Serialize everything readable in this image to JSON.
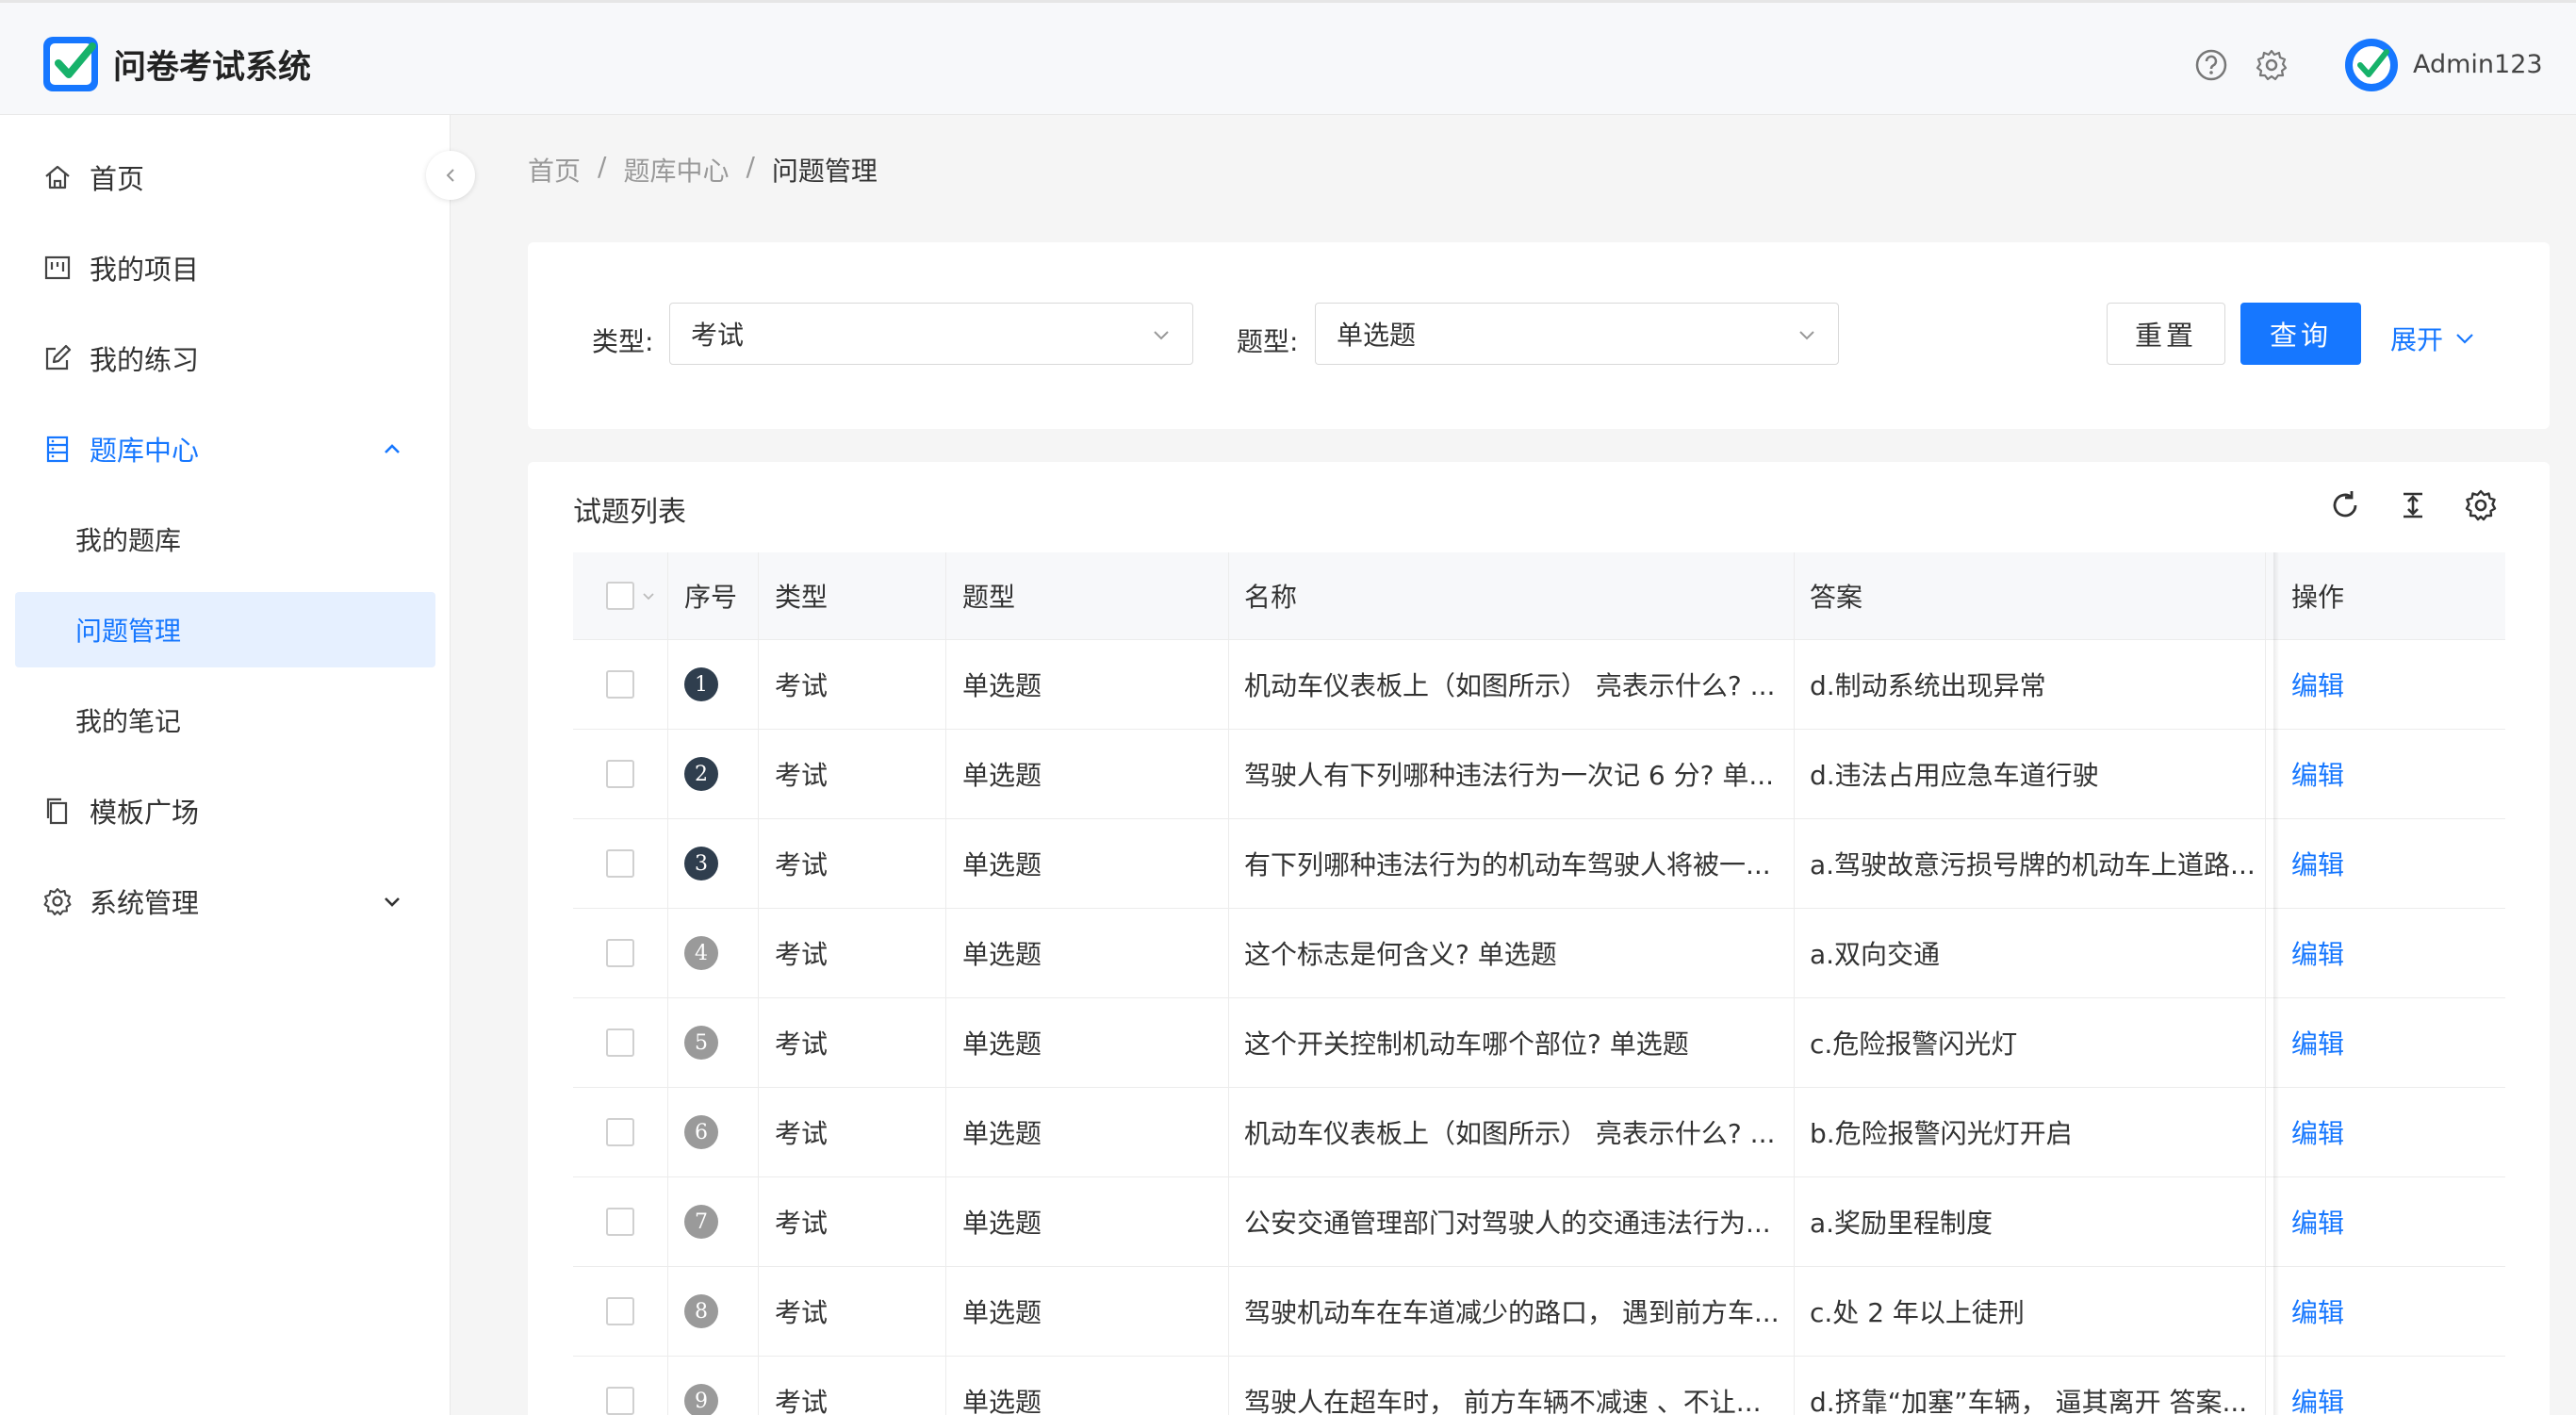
{
  "app": {
    "title": "问卷考试系统",
    "username": "Admin123"
  },
  "sidebar": {
    "items": [
      {
        "label": "首页",
        "icon": "home-icon"
      },
      {
        "label": "我的项目",
        "icon": "project-icon"
      },
      {
        "label": "我的练习",
        "icon": "edit-icon"
      },
      {
        "label": "题库中心",
        "icon": "database-icon"
      },
      {
        "label": "模板广场",
        "icon": "copy-icon"
      },
      {
        "label": "系统管理",
        "icon": "gear-icon"
      }
    ],
    "subitems": [
      {
        "label": "我的题库"
      },
      {
        "label": "问题管理"
      },
      {
        "label": "我的笔记"
      }
    ]
  },
  "breadcrumb": {
    "home": "首页",
    "parent": "题库中心",
    "current": "问题管理",
    "separator": "/"
  },
  "filter": {
    "type_label": "类型:",
    "type_value": "考试",
    "qtype_label": "题型:",
    "qtype_value": "单选题",
    "reset_label": "重置",
    "query_label": "查询",
    "expand_label": "展开"
  },
  "table": {
    "title": "试题列表",
    "columns": {
      "index": "序号",
      "type": "类型",
      "qtype": "题型",
      "name": "名称",
      "answer": "答案",
      "action": "操作"
    },
    "rows": [
      {
        "index": "1",
        "type": "考试",
        "qtype": "单选题",
        "name": "机动车仪表板上（如图所示） 亮表示什么? ...",
        "answer": "d.制动系统出现异常",
        "action": "编辑"
      },
      {
        "index": "2",
        "type": "考试",
        "qtype": "单选题",
        "name": "驾驶人有下列哪种违法行为一次记 6 分? 单...",
        "answer": "d.违法占用应急车道行驶",
        "action": "编辑"
      },
      {
        "index": "3",
        "type": "考试",
        "qtype": "单选题",
        "name": "有下列哪种违法行为的机动车驾驶人将被一...",
        "answer": "a.驾驶故意污损号牌的机动车上道路...",
        "action": "编辑"
      },
      {
        "index": "4",
        "type": "考试",
        "qtype": "单选题",
        "name": "这个标志是何含义? 单选题",
        "answer": "a.双向交通",
        "action": "编辑"
      },
      {
        "index": "5",
        "type": "考试",
        "qtype": "单选题",
        "name": "这个开关控制机动车哪个部位? 单选题",
        "answer": "c.危险报警闪光灯",
        "action": "编辑"
      },
      {
        "index": "6",
        "type": "考试",
        "qtype": "单选题",
        "name": "机动车仪表板上（如图所示） 亮表示什么? ...",
        "answer": "b.危险报警闪光灯开启",
        "action": "编辑"
      },
      {
        "index": "7",
        "type": "考试",
        "qtype": "单选题",
        "name": "公安交通管理部门对驾驶人的交通违法行为...",
        "answer": "a.奖励里程制度",
        "action": "编辑"
      },
      {
        "index": "8",
        "type": "考试",
        "qtype": "单选题",
        "name": "驾驶机动车在车道减少的路口， 遇到前方车...",
        "answer": "c.处 2 年以上徒刑",
        "action": "编辑"
      },
      {
        "index": "9",
        "type": "考试",
        "qtype": "单选题",
        "name": "驾驶人在超车时， 前方车辆不减速 、不让...",
        "answer": "d.挤靠“加塞”车辆， 逼其离开 答案...",
        "action": "编辑"
      }
    ]
  },
  "colors": {
    "accent": "#1677ff",
    "badge_dark": "#2f3e4e",
    "badge_gray": "#9a9a9a"
  }
}
